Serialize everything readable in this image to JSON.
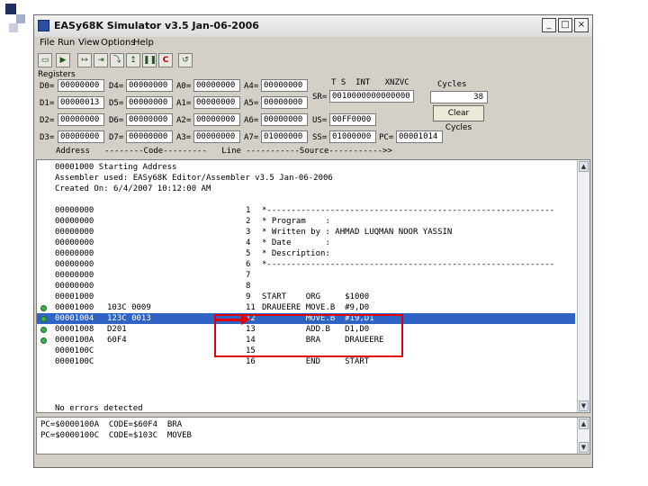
{
  "colors": {
    "accent_blue": "#2a4ea0",
    "selection": "#2f64c5",
    "highlight_red": "#e00000",
    "breakpoint_green": "#3cb24a"
  },
  "window": {
    "title": "EASy68K Simulator v3.5 Jan-06-2006",
    "buttons": {
      "minimize": "_",
      "maximize": "□",
      "close": "×"
    }
  },
  "menu": [
    "File",
    "Run",
    "View",
    "Options",
    "Help"
  ],
  "toolbar_icons": [
    "open-icon",
    "run-icon",
    "step-icon",
    "trace-icon",
    "step-over-icon",
    "run-to-cursor-icon",
    "pause-icon",
    "reset-icon",
    "rewind-icon",
    "log-icon"
  ],
  "registers": {
    "label": "Registers",
    "D0": "00000000",
    "D1": "00000013",
    "D2": "00000000",
    "D3": "00000000",
    "D4": "00000000",
    "D5": "00000000",
    "D6": "00000000",
    "D7": "00000000",
    "A0": "00000000",
    "A1": "00000000",
    "A2": "00000000",
    "A3": "00000000",
    "A4": "00000000",
    "A5": "00000000",
    "A6": "00000000",
    "A7": "01000000",
    "SR_header": "T S  INT   XNZVC",
    "SR": "0010000000000000",
    "US": "00FF0000",
    "SS": "01000000",
    "PC": "00001014",
    "cycles_label": "Cycles",
    "cycles_value": "38",
    "clear_cycles": "Clear Cycles"
  },
  "labels": {
    "D0": "D0=",
    "D1": "D1=",
    "D2": "D2=",
    "D3": "D3=",
    "D4": "D4=",
    "D5": "D5=",
    "D6": "D6=",
    "D7": "D7=",
    "A0": "A0=",
    "A1": "A1=",
    "A2": "A2=",
    "A3": "A3=",
    "A4": "A4=",
    "A5": "A5=",
    "A6": "A6=",
    "A7": "A7=",
    "SR": "SR=",
    "US": "US=",
    "SS": "SS=",
    "PC": "PC="
  },
  "columns_header": "Address   --------Code---------   Line -----------Source----------->>",
  "listing_header": [
    "00001000 Starting Address",
    "Assembler used: EASy68K Editor/Assembler v3.5 Jan-06-2006",
    "Created On: 6/4/2007 10:12:00 AM"
  ],
  "rows": [
    {
      "addr": "00000000",
      "code": "",
      "line": "1",
      "src": "*-----------------------------------------------------------",
      "dot": false,
      "sel": false
    },
    {
      "addr": "00000000",
      "code": "",
      "line": "2",
      "src": "* Program    :",
      "dot": false,
      "sel": false
    },
    {
      "addr": "00000000",
      "code": "",
      "line": "3",
      "src": "* Written by : AHMAD LUQMAN NOOR YASSIN",
      "dot": false,
      "sel": false
    },
    {
      "addr": "00000000",
      "code": "",
      "line": "4",
      "src": "* Date       :",
      "dot": false,
      "sel": false
    },
    {
      "addr": "00000000",
      "code": "",
      "line": "5",
      "src": "* Description:",
      "dot": false,
      "sel": false
    },
    {
      "addr": "00000000",
      "code": "",
      "line": "6",
      "src": "*-----------------------------------------------------------",
      "dot": false,
      "sel": false
    },
    {
      "addr": "00000000",
      "code": "",
      "line": "7",
      "src": "",
      "dot": false,
      "sel": false
    },
    {
      "addr": "00000000",
      "code": "",
      "line": "8",
      "src": "",
      "dot": false,
      "sel": false
    },
    {
      "addr": "00001000",
      "code": "",
      "line": "9",
      "src": "START    ORG     $1000",
      "dot": false,
      "sel": false
    },
    {
      "addr": "00001000",
      "code": "103C 0009",
      "line": "11",
      "src": "DRAUEERE MOVE.B  #9,D0",
      "dot": true,
      "sel": false
    },
    {
      "addr": "00001004",
      "code": "123C 0013",
      "line": "12",
      "src": "         MOVE.B  #19,D1",
      "dot": true,
      "sel": true
    },
    {
      "addr": "00001008",
      "code": "D201",
      "line": "13",
      "src": "         ADD.B   D1,D0",
      "dot": true,
      "sel": false
    },
    {
      "addr": "0000100A",
      "code": "60F4",
      "line": "14",
      "src": "         BRA     DRAUEERE",
      "dot": true,
      "sel": false
    },
    {
      "addr": "0000100C",
      "code": "",
      "line": "15",
      "src": "",
      "dot": false,
      "sel": false
    },
    {
      "addr": "0000100C",
      "code": "",
      "line": "16",
      "src": "         END     START",
      "dot": false,
      "sel": false
    }
  ],
  "footer": "No errors detected",
  "output": [
    "PC=$0000100A  CODE=$60F4  BRA",
    "PC=$0000100C  CODE=$103C  MOVEB"
  ]
}
